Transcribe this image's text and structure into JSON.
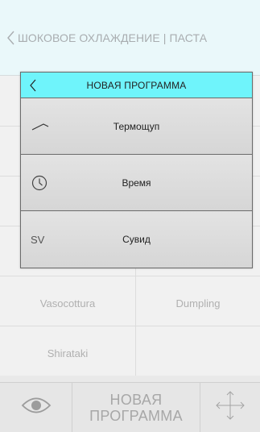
{
  "header": {
    "title": "ШОКОВОЕ ОХЛАЖДЕНИЕ | ПАСТА"
  },
  "grid": {
    "rows": [
      {
        "left": "",
        "right": ""
      },
      {
        "left": "",
        "right": ""
      },
      {
        "left": "",
        "right": ""
      },
      {
        "left": "",
        "right": ""
      },
      {
        "left": "Vasocottura",
        "right": "Dumpling"
      },
      {
        "left": "Shirataki",
        "right": ""
      }
    ]
  },
  "dialog": {
    "title": "НОВАЯ ПРОГРАММА",
    "options": [
      {
        "icon": "probe-icon",
        "label": "Термощуп"
      },
      {
        "icon": "clock-icon",
        "label": "Время"
      },
      {
        "icon": "sv-icon",
        "icon_text": "SV",
        "label": "Сувид"
      }
    ]
  },
  "footer": {
    "new_program_line1": "НОВАЯ",
    "new_program_line2": "ПРОГРАММА",
    "eye_icon": "eye-icon",
    "move_icon": "move-arrows-icon"
  },
  "colors": {
    "header_bg": "#eaf8fa",
    "dialog_header_bg": "#6ff4fb",
    "grid_text": "#b0b0b0"
  }
}
